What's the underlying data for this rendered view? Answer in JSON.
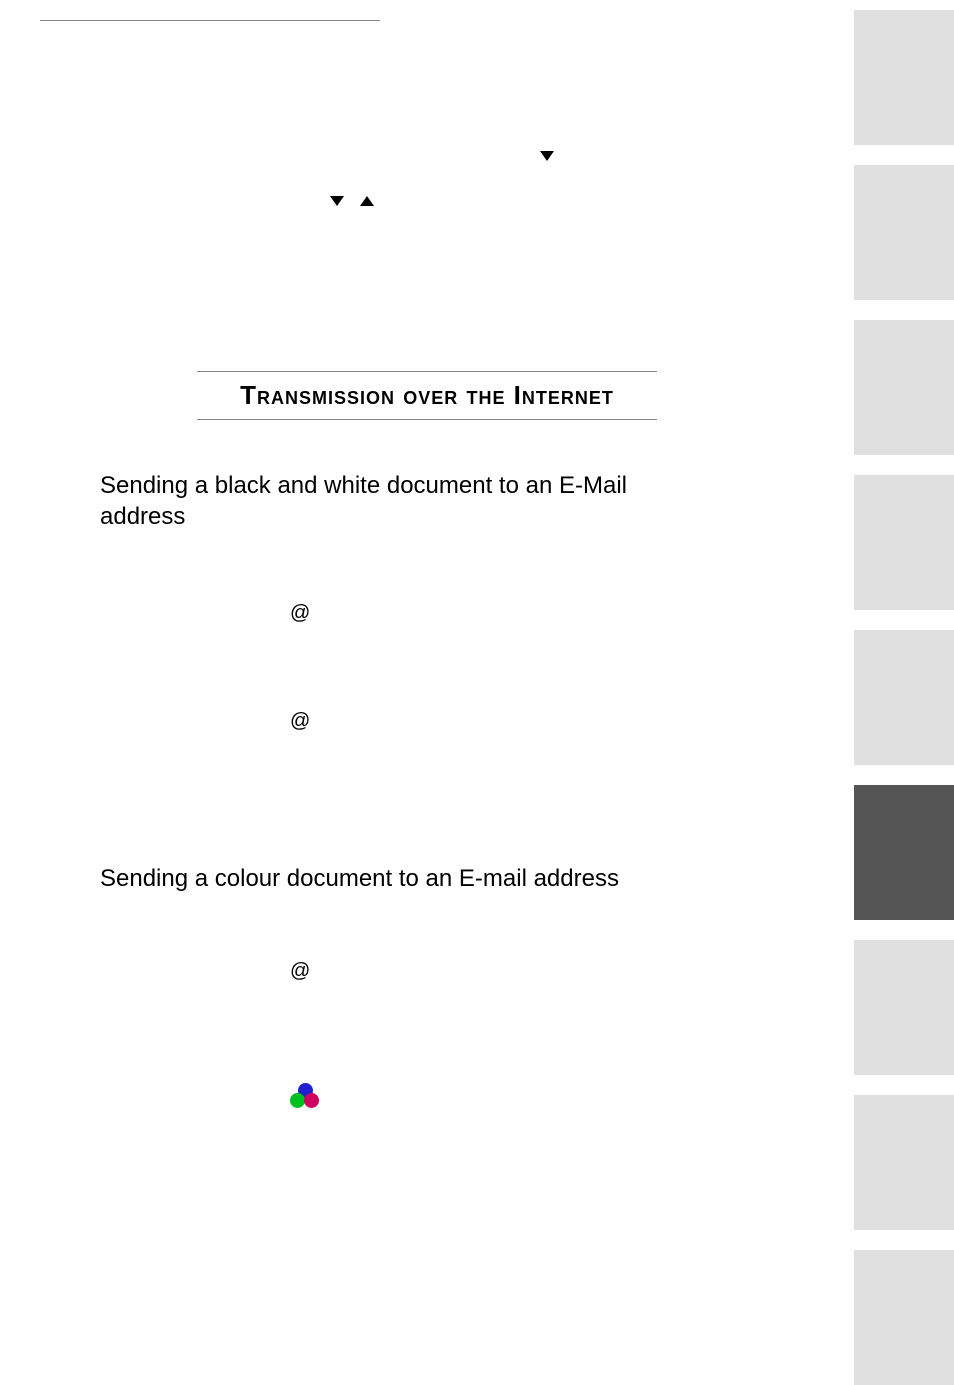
{
  "section_title": "Transmission over the Internet",
  "subsection_bw": "Sending a black and white document to an E-Mail address",
  "subsection_color": "Sending a colour document to an E-mail address",
  "at_symbol": "@",
  "icons": {
    "arrow_down": "chevron-down",
    "arrow_up": "chevron-up",
    "rgb": "color-circles"
  }
}
